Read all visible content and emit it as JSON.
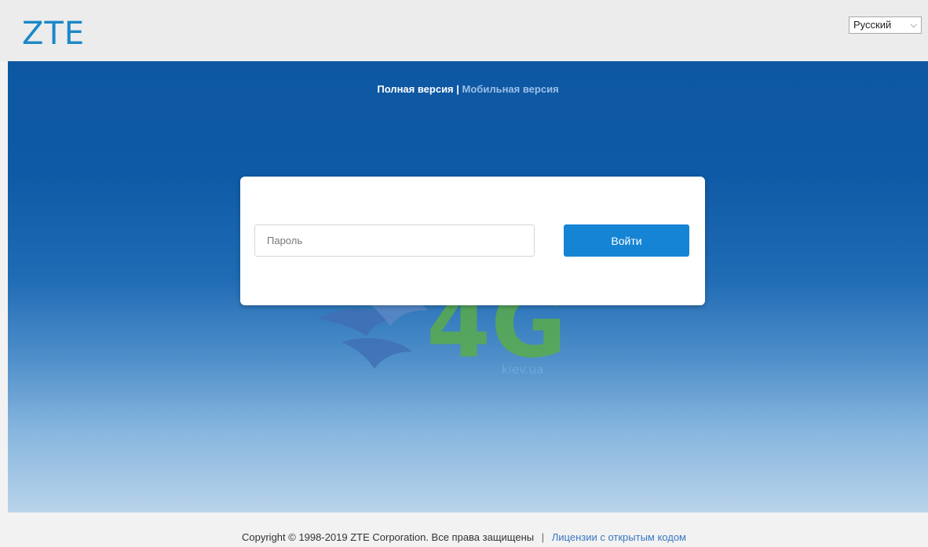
{
  "header": {
    "logo_text": "ZTE",
    "language_selected": "Русский"
  },
  "version_switch": {
    "full": "Полная версия",
    "separator": "|",
    "mobile": "Мобильная версия"
  },
  "login": {
    "password_placeholder": "Пароль",
    "password_value": "",
    "submit_label": "Войти"
  },
  "watermark": {
    "text": "kiev.ua",
    "big_text": "4G"
  },
  "footer": {
    "copyright": "Copyright © 1998-2019 ZTE Corporation. Все права защищены",
    "separator": "|",
    "license_link": "Лицензии с открытым кодом"
  },
  "colors": {
    "brand_blue": "#1a88c8",
    "button_blue": "#1684d4",
    "hero_top": "#0d57a3",
    "hero_bottom": "#b9d4ea",
    "watermark_green": "#5cae45"
  }
}
